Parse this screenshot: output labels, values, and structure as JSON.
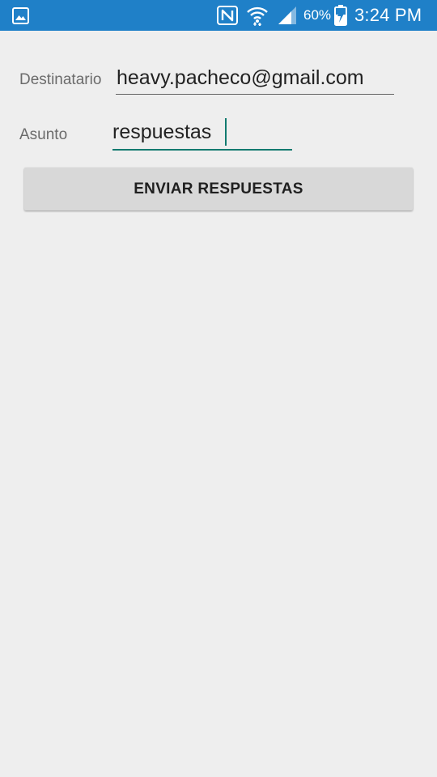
{
  "status_bar": {
    "battery_percent": "60%",
    "time": "3:24 PM",
    "icons": [
      "gallery-icon",
      "nfc-icon",
      "wifi-icon",
      "signal-icon",
      "battery-charging-icon"
    ]
  },
  "form": {
    "recipient_label": "Destinatario",
    "recipient_value": "heavy.pacheco@gmail.com",
    "subject_label": "Asunto",
    "subject_value": "respuestas",
    "send_button_label": "ENVIAR RESPUESTAS"
  },
  "colors": {
    "status_bar": "#1f80c8",
    "background": "#eeeeee",
    "accent": "#117a6f",
    "button": "#d8d8d8"
  }
}
